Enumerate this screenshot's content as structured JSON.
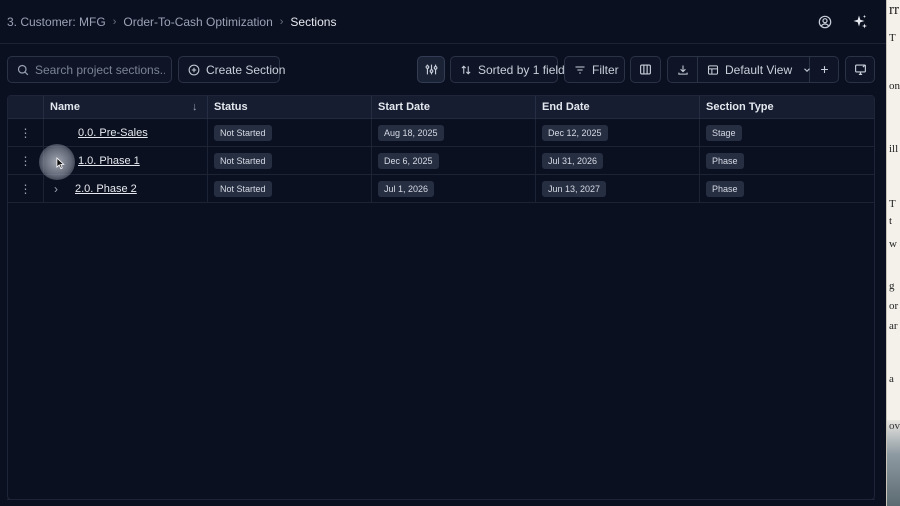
{
  "breadcrumb": {
    "items": [
      "3. Customer: MFG",
      "Order-To-Cash Optimization",
      "Sections"
    ]
  },
  "header": {
    "icons": [
      "user-circle-icon",
      "sparkle-icon"
    ]
  },
  "toolbar": {
    "search_placeholder": "Search project sections...",
    "create_label": "Create Section",
    "sorted_label": "Sorted by 1 field",
    "filter_label": "Filter",
    "view_label": "Default View"
  },
  "table": {
    "columns": [
      "Name",
      "Status",
      "Start Date",
      "End Date",
      "Section Type"
    ],
    "rows": [
      {
        "name": "0.0. Pre-Sales",
        "status": "Not Started",
        "start": "Aug 18, 2025",
        "end": "Dec 12, 2025",
        "type": "Stage"
      },
      {
        "name": "1.0. Phase 1",
        "status": "Not Started",
        "start": "Dec 6, 2025",
        "end": "Jul 31, 2026",
        "type": "Phase"
      },
      {
        "name": "2.0. Phase 2",
        "status": "Not Started",
        "start": "Jul 1, 2026",
        "end": "Jun 13, 2027",
        "type": "Phase"
      }
    ]
  },
  "side_window": {
    "fragments": [
      "rr",
      "T",
      "on",
      "ill",
      "T",
      "t",
      "w",
      "g",
      "or",
      "ar",
      "a",
      "ov"
    ]
  },
  "colors": {
    "background": "#0b1020",
    "header_row": "#161d30",
    "pill": "#262e42"
  }
}
